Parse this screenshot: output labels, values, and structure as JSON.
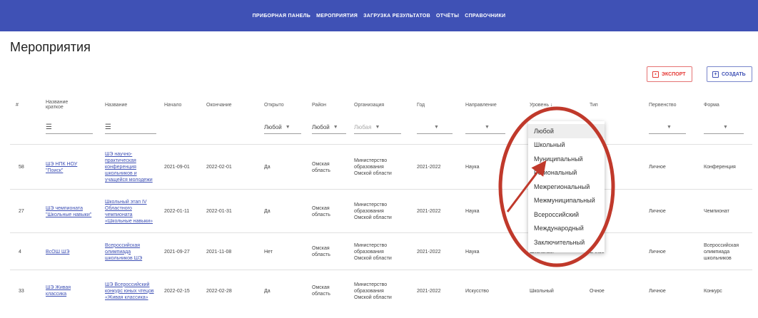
{
  "nav": {
    "items": [
      "ПРИБОРНАЯ ПАНЕЛЬ",
      "МЕРОПРИЯТИЯ",
      "ЗАГРУЗКА РЕЗУЛЬТАТОВ",
      "ОТЧЁТЫ",
      "СПРАВОЧНИКИ"
    ]
  },
  "page": {
    "title": "Мероприятия"
  },
  "toolbar": {
    "export_label": "ЭКСПОРТ",
    "create_label": "СОЗДАТЬ"
  },
  "table": {
    "headers": {
      "num": "#",
      "short_name": "Название краткое",
      "name": "Название",
      "start": "Начало",
      "end": "Окончание",
      "open": "Открыто",
      "district": "Район",
      "org": "Организация",
      "year": "Год",
      "direction": "Направление",
      "level": "Уровень ↓",
      "type": "Тип",
      "primacy": "Первенство",
      "form": "Форма"
    },
    "filters": {
      "open": "Любой",
      "district": "Любой",
      "org": "Любая"
    },
    "rows": [
      {
        "num": "58",
        "short_name": "ШЭ НПК НОУ \"Поиск\"",
        "name": "ШЭ научно-практическая конференция школьников и учащейся молодежи",
        "start": "2021-09-01",
        "end": "2022-02-01",
        "open": "Да",
        "district": "Омская область",
        "org": "Министерство образования Омской области",
        "year": "2021-2022",
        "direction": "Наука",
        "level": "",
        "type": "",
        "primacy": "Личное",
        "form": "Конференция"
      },
      {
        "num": "27",
        "short_name": "ШЭ чемпионата \"Школьные навыки\"",
        "name": "Школьный этап IV Областного чемпионата «Школьные навыки»",
        "start": "2022-01-11",
        "end": "2022-01-31",
        "open": "Да",
        "district": "Омская область",
        "org": "Министерство образования Омской области",
        "year": "2021-2022",
        "direction": "Наука",
        "level": "",
        "type": "",
        "primacy": "Личное",
        "form": "Чемпионат"
      },
      {
        "num": "4",
        "short_name": "ВсОШ ШЭ",
        "name": "Всероссийская олимпиада школьников ШЭ",
        "start": "2021-09-27",
        "end": "2021-11-08",
        "open": "Нет",
        "district": "Омская область",
        "org": "Министерство образования Омской области",
        "year": "2021-2022",
        "direction": "Наука",
        "level": "Школьный",
        "type": "Очное",
        "primacy": "Личное",
        "form": "Всероссийская олимпиада школьников"
      },
      {
        "num": "33",
        "short_name": "ШЭ Живая классика",
        "name": "ШЭ Всероссийский конкурс юных чтецов «Живая классика»",
        "start": "2022-02-15",
        "end": "2022-02-28",
        "open": "Да",
        "district": "Омская область",
        "org": "Министерство образования Омской области",
        "year": "2021-2022",
        "direction": "Искусство",
        "level": "Школьный",
        "type": "Очное",
        "primacy": "Личное",
        "form": "Конкурс"
      }
    ]
  },
  "dropdown": {
    "options": [
      "Любой",
      "Школьный",
      "Муниципальный",
      "Региональный",
      "Межрегиональный",
      "Межмуниципальный",
      "Всероссийский",
      "Международный",
      "Заключительный"
    ]
  },
  "annotation": {
    "color": "#c0392b"
  },
  "theme": {
    "primary": "#3f51b5",
    "danger": "#e53935"
  }
}
